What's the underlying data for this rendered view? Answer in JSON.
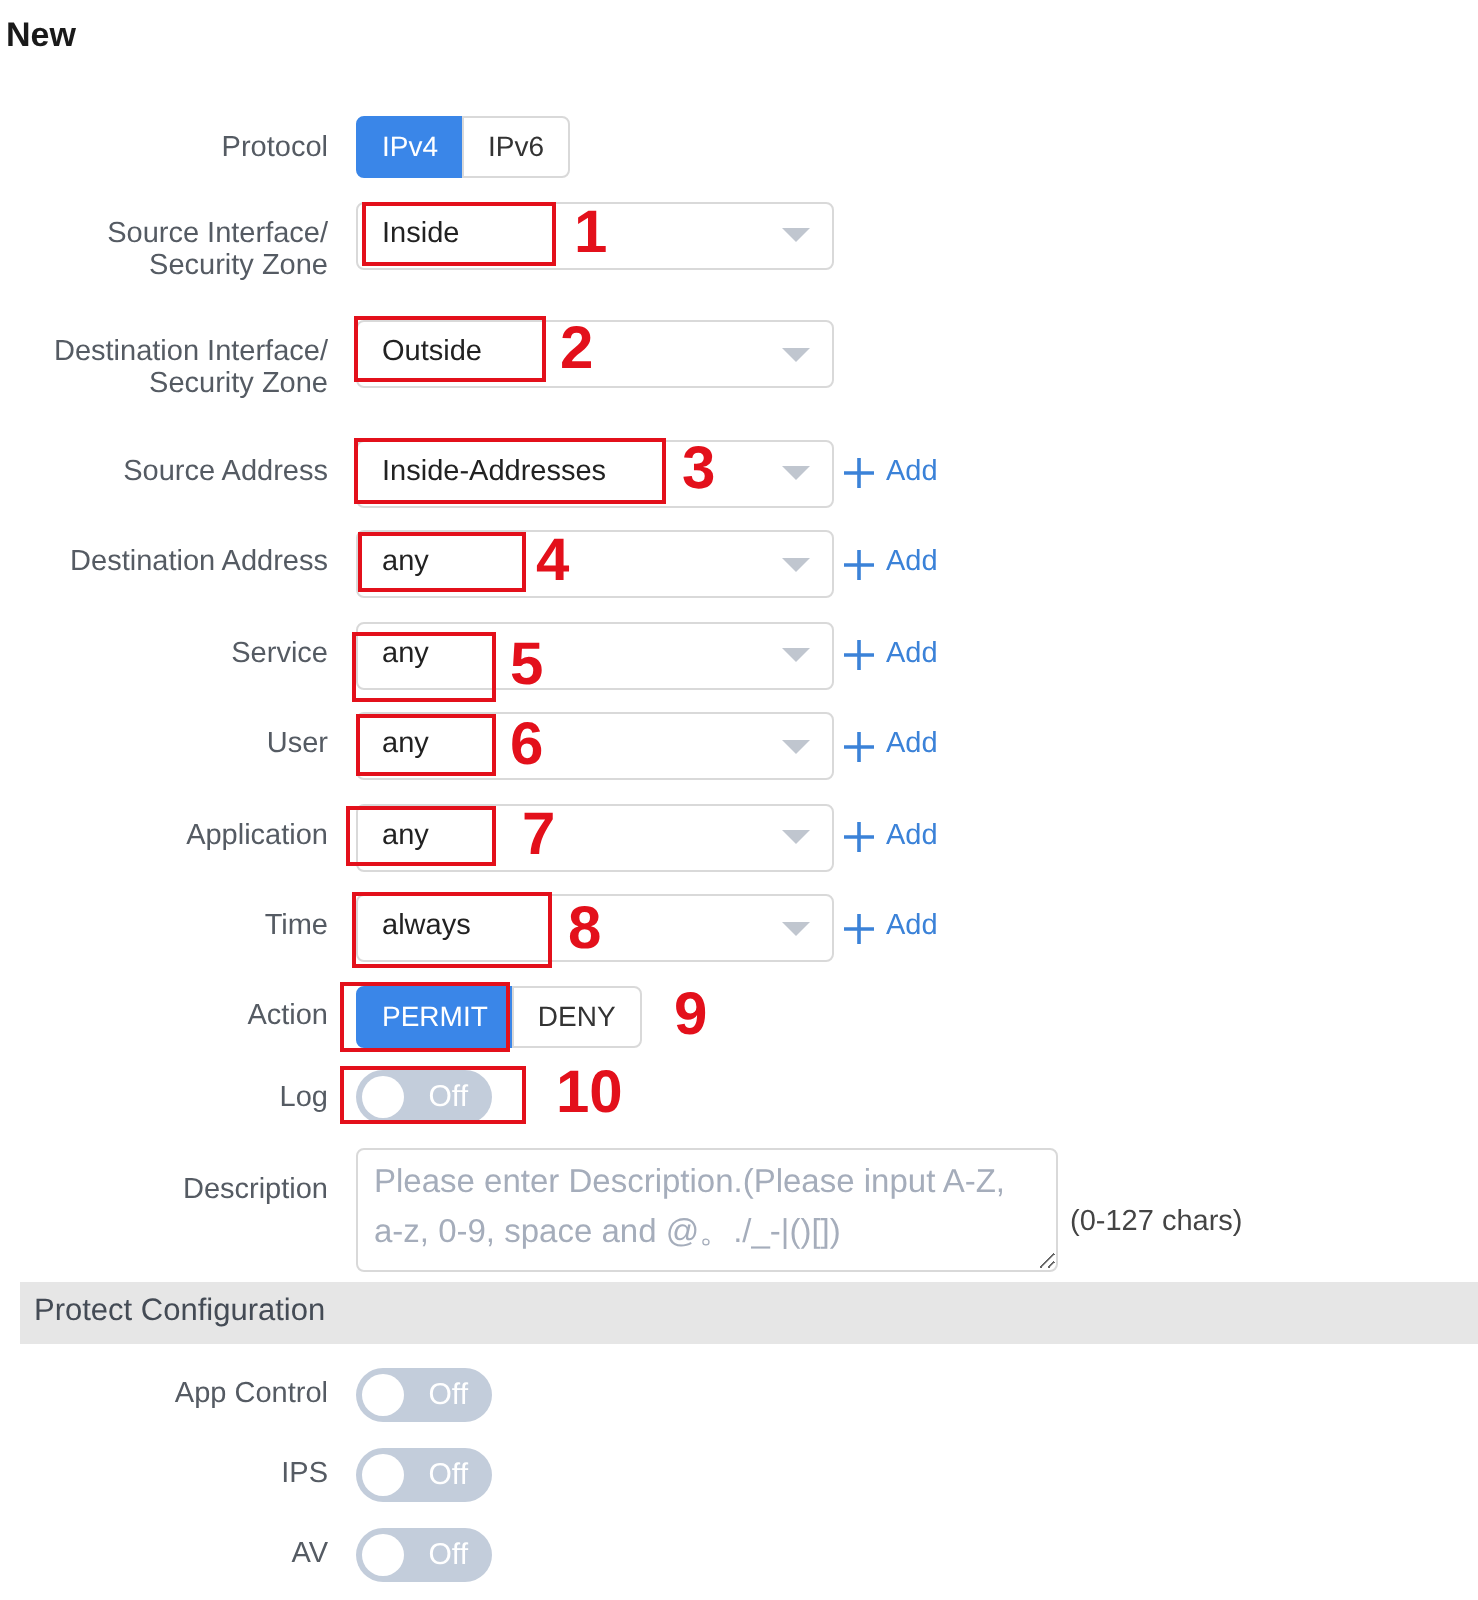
{
  "title": "New",
  "form": [
    {
      "kind": "segmented",
      "label": "Protocol",
      "options": [
        {
          "label": "IPv4",
          "selected": true
        },
        {
          "label": "IPv6",
          "selected": false
        }
      ]
    },
    {
      "kind": "select",
      "label": "Source Interface/\nSecurity Zone",
      "value": "Inside",
      "annotation": "1"
    },
    {
      "kind": "select",
      "label": "Destination Interface/\nSecurity Zone",
      "value": "Outside",
      "annotation": "2"
    },
    {
      "kind": "select",
      "label": "Source Address",
      "value": "Inside-Addresses",
      "add_link": "Add",
      "annotation": "3"
    },
    {
      "kind": "select",
      "label": "Destination Address",
      "value": "any",
      "add_link": "Add",
      "annotation": "4"
    },
    {
      "kind": "select",
      "label": "Service",
      "value": "any",
      "add_link": "Add",
      "annotation": "5"
    },
    {
      "kind": "select",
      "label": "User",
      "value": "any",
      "add_link": "Add",
      "annotation": "6"
    },
    {
      "kind": "select",
      "label": "Application",
      "value": "any",
      "add_link": "Add",
      "annotation": "7"
    },
    {
      "kind": "select",
      "label": "Time",
      "value": "always",
      "add_link": "Add",
      "annotation": "8"
    },
    {
      "kind": "segmented",
      "label": "Action",
      "options": [
        {
          "label": "PERMIT",
          "selected": true
        },
        {
          "label": "DENY",
          "selected": false
        }
      ],
      "annotation": "9"
    },
    {
      "kind": "toggle",
      "label": "Log",
      "on": false,
      "state_text": "Off",
      "annotation": "10"
    },
    {
      "kind": "textarea",
      "label": "Description",
      "placeholder": "Please enter Description.(Please input A-Z, a-z, 0-9, space and @。./_-|()[])",
      "hint": "(0-127 chars)"
    }
  ],
  "protect_configuration": {
    "title": "Protect Configuration",
    "items": [
      {
        "label": "App Control",
        "on": false,
        "state_text": "Off"
      },
      {
        "label": "IPS",
        "on": false,
        "state_text": "Off"
      },
      {
        "label": "AV",
        "on": false,
        "state_text": "Off"
      }
    ]
  }
}
